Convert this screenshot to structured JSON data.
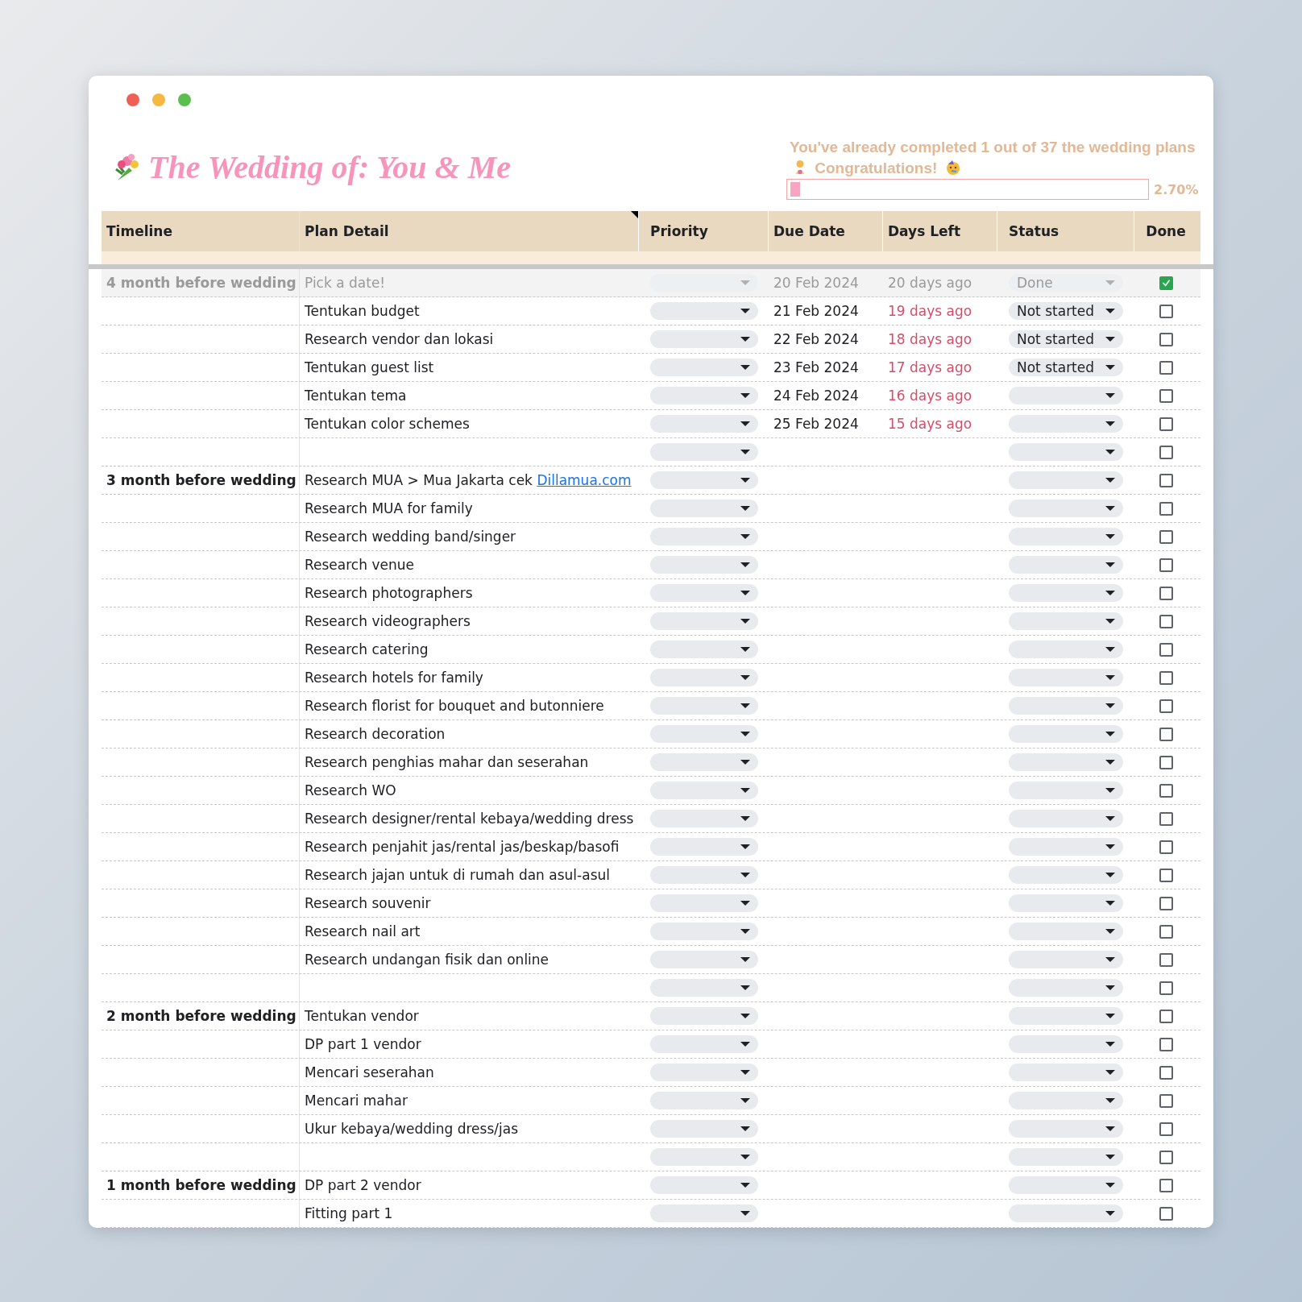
{
  "window": {
    "title": "The Wedding of: You & Me"
  },
  "progress": {
    "message": "You've already completed 1 out of 37 the wedding plans",
    "congrats": "Congratulations!",
    "level": 0.027,
    "reading": "2.70%"
  },
  "table": {
    "columns": [
      "Timeline",
      "Plan Detail",
      "Priority",
      "Due Date",
      "Days Left",
      "Status",
      "Done"
    ],
    "rows": [
      {
        "timeline": "4 month before wedding",
        "detail": "Pick a date!",
        "due": "20 Feb 2024",
        "days_left": "20 days ago",
        "status": "Done",
        "done": true
      },
      {
        "detail": "Tentukan budget",
        "due": "21 Feb 2024",
        "days_left": "19 days ago",
        "status": "Not started",
        "done": false
      },
      {
        "detail": "Research vendor dan lokasi",
        "due": "22 Feb 2024",
        "days_left": "18 days ago",
        "status": "Not started",
        "done": false
      },
      {
        "detail": "Tentukan guest list",
        "due": "23 Feb 2024",
        "days_left": "17 days ago",
        "status": "Not started",
        "done": false
      },
      {
        "detail": "Tentukan tema",
        "due": "24 Feb 2024",
        "days_left": "16 days ago",
        "done": false
      },
      {
        "detail": "Tentukan color schemes",
        "due": "25 Feb 2024",
        "days_left": "15 days ago",
        "done": false
      },
      {
        "done": false
      },
      {
        "timeline": "3 month before wedding",
        "detail": "Research MUA > Mua Jakarta cek ",
        "link": "Dillamua.com",
        "done": false
      },
      {
        "detail": "Research MUA for family",
        "done": false
      },
      {
        "detail": "Research wedding band/singer",
        "done": false
      },
      {
        "detail": "Research venue",
        "done": false
      },
      {
        "detail": "Research photographers",
        "done": false
      },
      {
        "detail": "Research videographers",
        "done": false
      },
      {
        "detail": "Research catering",
        "done": false
      },
      {
        "detail": "Research hotels for family",
        "done": false
      },
      {
        "detail": "Research florist for bouquet and butonniere",
        "done": false
      },
      {
        "detail": "Research decoration",
        "done": false
      },
      {
        "detail": "Research penghias mahar dan seserahan",
        "done": false
      },
      {
        "detail": "Research WO",
        "done": false
      },
      {
        "detail": "Research designer/rental kebaya/wedding dress",
        "done": false
      },
      {
        "detail": "Research penjahit jas/rental jas/beskap/basofi",
        "done": false
      },
      {
        "detail": "Research jajan untuk di rumah dan asul-asul",
        "done": false
      },
      {
        "detail": "Research souvenir",
        "done": false
      },
      {
        "detail": "Research nail art",
        "done": false
      },
      {
        "detail": "Research undangan fisik dan online",
        "done": false
      },
      {
        "done": false
      },
      {
        "timeline": "2 month before wedding",
        "detail": "Tentukan vendor",
        "done": false
      },
      {
        "detail": "DP part 1 vendor",
        "done": false
      },
      {
        "detail": "Mencari seserahan",
        "done": false
      },
      {
        "detail": "Mencari mahar",
        "done": false
      },
      {
        "detail": "Ukur kebaya/wedding dress/jas",
        "done": false
      },
      {
        "done": false
      },
      {
        "timeline": "1 month before wedding",
        "detail": "DP part 2 vendor",
        "done": false
      },
      {
        "detail": "Fitting part 1",
        "done": false
      }
    ]
  }
}
